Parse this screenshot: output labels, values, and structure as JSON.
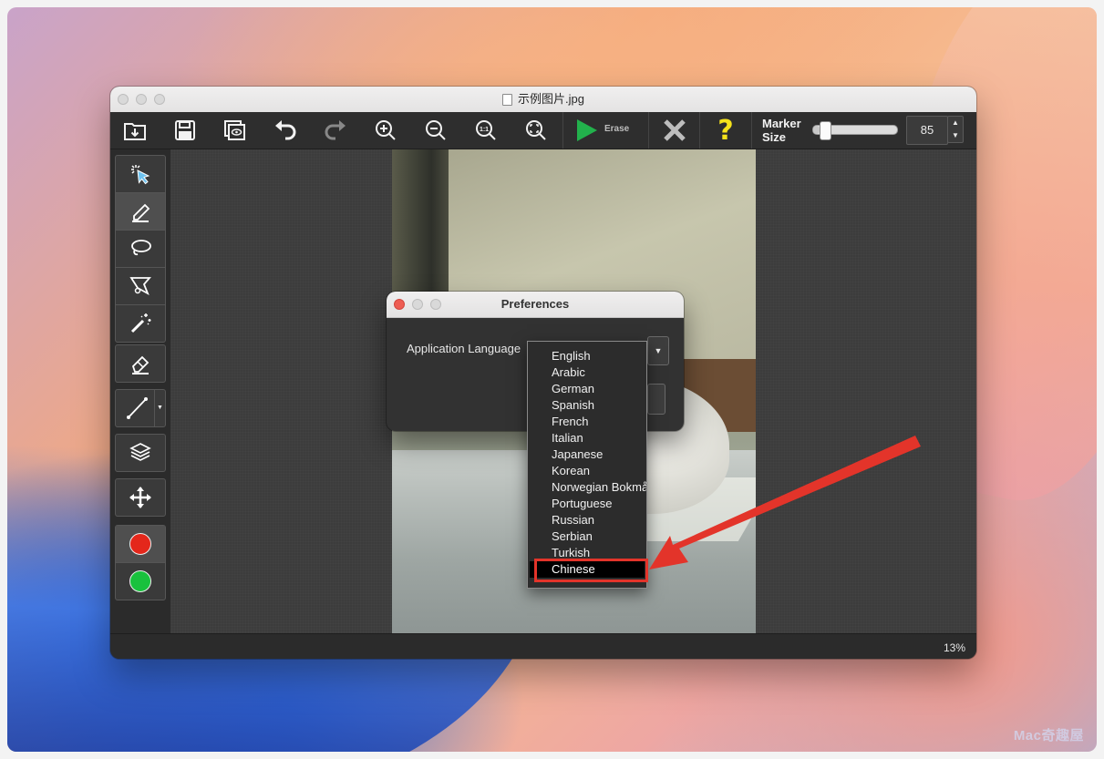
{
  "window": {
    "title": "示例图片.jpg"
  },
  "toolbar": {
    "items": [
      {
        "name": "open-icon"
      },
      {
        "name": "save-icon"
      },
      {
        "name": "preview-icon"
      },
      {
        "name": "undo-icon"
      },
      {
        "name": "redo-icon"
      },
      {
        "name": "zoom-in-icon"
      },
      {
        "name": "zoom-out-icon"
      },
      {
        "name": "actual-size-icon"
      },
      {
        "name": "fit-to-window-icon"
      }
    ],
    "erase_label": "Erase",
    "marker_size_label": "Marker Size",
    "marker_size_value": "85",
    "marker_slider_fraction": 0.08
  },
  "tools": {
    "group1": [
      "selection-pointer-icon",
      "marker-icon",
      "lasso-icon",
      "polygon-lasso-icon",
      "magic-wand-icon"
    ],
    "eraser": "eraser-icon",
    "line": "line-tool-icon",
    "layers": "layers-icon",
    "move": "move-icon",
    "colors": [
      {
        "name": "red-marker-color",
        "hex": "#e4271b"
      },
      {
        "name": "green-marker-color",
        "hex": "#19c13d"
      }
    ]
  },
  "status": {
    "zoom": "13%"
  },
  "preferences": {
    "title": "Preferences",
    "language_label": "Application Language",
    "languages": [
      "English",
      "Arabic",
      "German",
      "Spanish",
      "French",
      "Italian",
      "Japanese",
      "Korean",
      "Norwegian Bokmål",
      "Portuguese",
      "Russian",
      "Serbian",
      "Turkish",
      "Chinese"
    ],
    "selected_language": "Chinese"
  },
  "colors": {
    "accent_green": "#22b14c",
    "help_yellow": "#f5e21b",
    "annotation_red": "#e3342a"
  },
  "watermark": "Mac奇趣屋"
}
